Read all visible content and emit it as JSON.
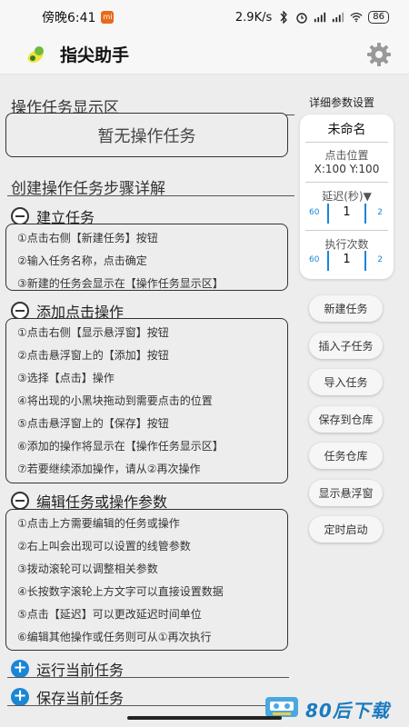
{
  "status_bar": {
    "time": "傍晚6:41",
    "speed": "2.9K/s",
    "battery": "86"
  },
  "app": {
    "title": "指尖助手"
  },
  "display_area": {
    "title": "操作任务显示区",
    "empty_text": "暂无操作任务"
  },
  "guide": {
    "title": "创建操作任务步骤详解",
    "groups": [
      {
        "title": "建立任务",
        "steps": [
          "①点击右侧【新建任务】按钮",
          "②输入任务名称，点击确定",
          "③新建的任务会显示在【操作任务显示区】"
        ]
      },
      {
        "title": "添加点击操作",
        "steps": [
          "①点击右侧【显示悬浮窗】按钮",
          "②点击悬浮窗上的【添加】按钮",
          "③选择【点击】操作",
          "④将出现的小黑块拖动到需要点击的位置",
          "⑤点击悬浮窗上的【保存】按钮",
          "⑥添加的操作将显示在【操作任务显示区】",
          "⑦若要继续添加操作，请从②再次操作"
        ]
      },
      {
        "title": "编辑任务或操作参数",
        "steps": [
          "①点击上方需要编辑的任务或操作",
          "②右上叫会出现可以设置的线管参数",
          "③拨动滚轮可以调整相关参数",
          "④长按数字滚轮上方文字可以直接设置数据",
          "⑤点击【延迟】可以更改延迟时间单位",
          "⑥编辑其他操作或任务则可从①再次执行"
        ]
      }
    ],
    "run_label": "运行当前任务",
    "save_label": "保存当前任务"
  },
  "params": {
    "title": "详细参数设置",
    "name": "未命名",
    "click_pos_label": "点击位置",
    "click_pos_value": "X:100  Y:100",
    "delay_label": "延迟(秒)▼",
    "delay_wheel": {
      "prev": "60",
      "value": "1",
      "next": "2"
    },
    "repeat_label": "执行次数",
    "repeat_wheel": {
      "prev": "60",
      "value": "1",
      "next": "2"
    }
  },
  "actions": {
    "new_task": "新建任务",
    "insert_subtask": "插入子任务",
    "import_task": "导入任务",
    "save_to_repo": "保存到仓库",
    "task_repo": "任务仓库",
    "show_float": "显示悬浮窗",
    "timer_start": "定时启动"
  },
  "watermark": {
    "text": "80后下载"
  },
  "colors": {
    "accent": "#1a86d6",
    "background": "#ededed"
  }
}
